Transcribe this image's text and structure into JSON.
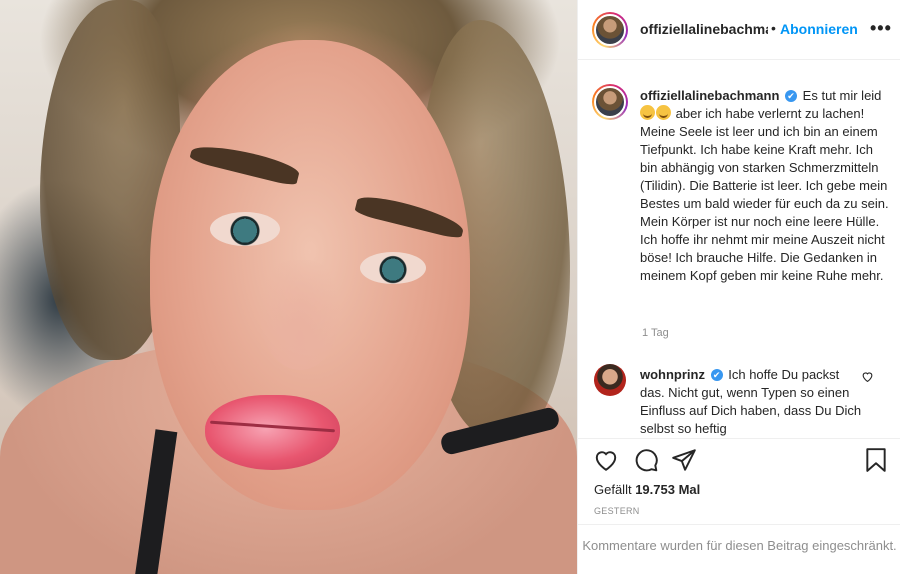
{
  "header": {
    "username": "offiziellalinebachmann",
    "separator": "•",
    "follow_label": "Abonnieren",
    "more_label": "•••"
  },
  "caption": {
    "username": "offiziellalinebachmann",
    "verified_mark": "✔",
    "text_part1": "Es tut mir leid",
    "text_part2": "aber ich habe verlernt zu lachen! Meine Seele ist leer und ich bin an einem Tiefpunkt. Ich habe keine Kraft mehr. Ich bin abhängig von starken Schmerzmitteln (Tilidin). Die Batterie ist leer. Ich gebe mein Bestes um bald wieder für euch da zu sein. Mein Körper ist nur noch eine leere Hülle. Ich hoffe ihr nehmt mir meine Auszeit nicht böse! Ich brauche Hilfe. Die Gedanken in meinem Kopf geben mir keine Ruhe mehr.",
    "emojis": [
      "sad-face-emoji",
      "crying-face-emoji"
    ],
    "time": "1 Tag"
  },
  "comment": {
    "username": "wohnprinz",
    "verified_mark": "✔",
    "text": "Ich hoffe Du packst das. Nicht gut, wenn Typen so einen Einfluss auf Dich haben, dass Du Dich selbst so heftig"
  },
  "actions": {
    "icons": [
      "heart-icon",
      "comment-icon",
      "share-icon",
      "bookmark-icon"
    ],
    "likes_label": "Gefällt",
    "likes_count": "19.753",
    "likes_unit": "Mal",
    "posted": "GESTERN",
    "comments_disabled": "Kommentare wurden für diesen Beitrag eingeschränkt."
  },
  "colors": {
    "link_blue": "#0095f6",
    "verified_blue": "#3897f0",
    "muted_text": "#8e8e8e",
    "border": "#efefef"
  }
}
